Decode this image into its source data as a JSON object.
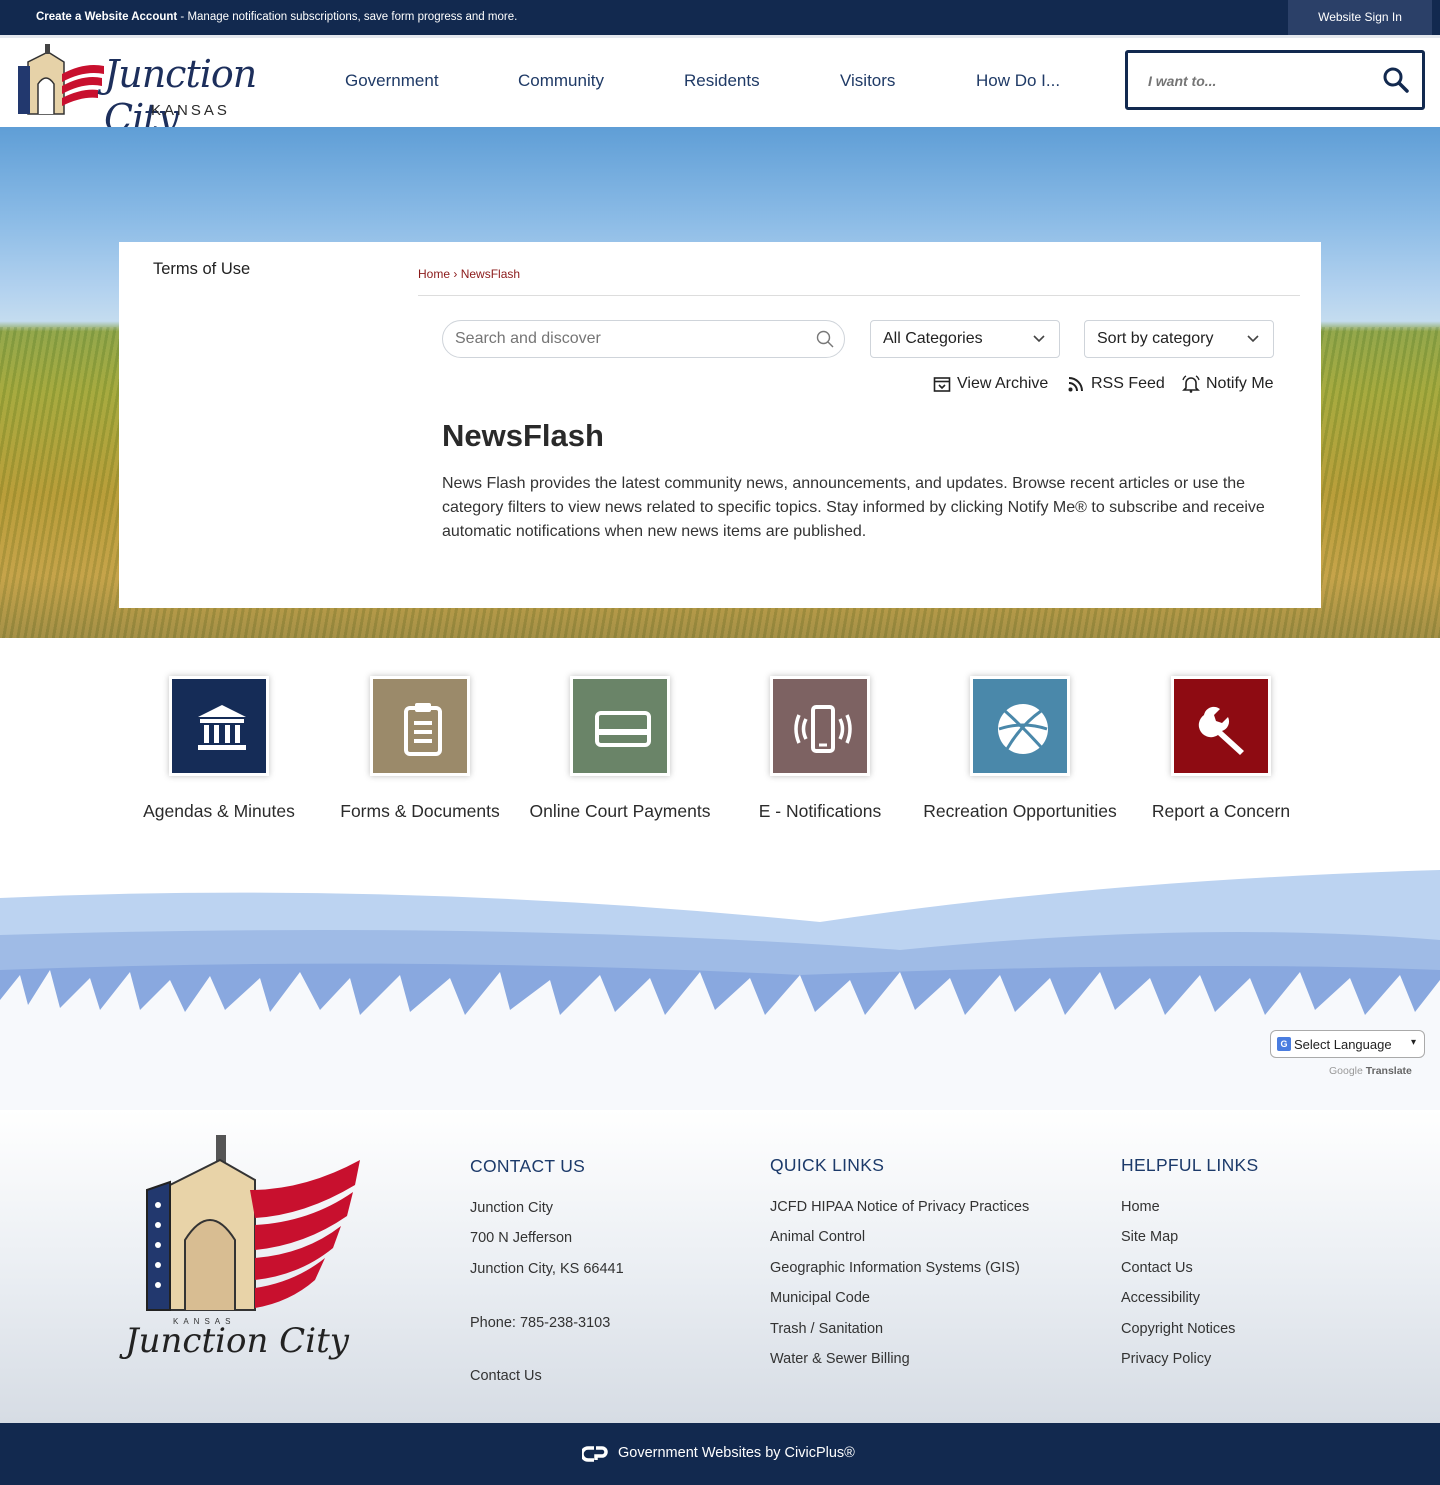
{
  "topbar": {
    "create_account": "Create a Website Account",
    "message": " - Manage notification subscriptions, save form progress and more.",
    "sign_in": "Website Sign In"
  },
  "header": {
    "logo_script": "Junction City",
    "logo_state": "KANSAS",
    "nav": [
      "Government",
      "Community",
      "Residents",
      "Visitors",
      "How Do I..."
    ],
    "iwant_placeholder": "I want to..."
  },
  "sidebar": {
    "link": "Terms of Use"
  },
  "breadcrumb": {
    "home": "Home",
    "separator": " › ",
    "current": "NewsFlash"
  },
  "filters": {
    "search_placeholder": "Search and discover",
    "category": "All Categories",
    "sort": "Sort by category"
  },
  "actions": {
    "archive": "View Archive",
    "rss": "RSS Feed",
    "notify": "Notify Me"
  },
  "page": {
    "title": "NewsFlash",
    "description": "News Flash provides the latest community news, announcements, and updates. Browse recent articles or use the category filters to view news related to specific topics. Stay informed by clicking Notify Me® to subscribe and receive automatic notifications when new news items are published."
  },
  "tiles": [
    {
      "label": "Agendas & Minutes",
      "color": "#152c57",
      "icon": "government-building-icon"
    },
    {
      "label": "Forms & Documents",
      "color": "#9b8a6a",
      "icon": "clipboard-icon"
    },
    {
      "label": "Online Court Payments",
      "color": "#6a8468",
      "icon": "credit-card-icon"
    },
    {
      "label": "E - Notifications",
      "color": "#7d6262",
      "icon": "vibrating-phone-icon"
    },
    {
      "label": "Recreation Opportunities",
      "color": "#4a88aa",
      "icon": "basketball-icon"
    },
    {
      "label": "Report a Concern",
      "color": "#8e0b12",
      "icon": "wrench-icon"
    }
  ],
  "translate": {
    "select": "Select Language",
    "powered_prefix": "Google",
    "powered": "Translate"
  },
  "footer": {
    "contact": {
      "heading": "CONTACT US",
      "name": "Junction City",
      "street": "700 N Jefferson",
      "city": "Junction City, KS 66441",
      "phone": "Phone: 785-238-3103",
      "link": "Contact Us"
    },
    "quick_links": {
      "heading": "QUICK LINKS",
      "items": [
        "JCFD HIPAA Notice of Privacy Practices",
        "Animal Control",
        "Geographic Information Systems (GIS)",
        "Municipal Code",
        "Trash / Sanitation",
        "Water & Sewer Billing"
      ]
    },
    "helpful_links": {
      "heading": "HELPFUL LINKS",
      "items": [
        "Home",
        "Site Map",
        "Contact Us",
        "Accessibility",
        "Copyright Notices",
        "Privacy Policy"
      ]
    },
    "logo_state": "KANSAS",
    "logo_script": "Junction City",
    "credit": "Government Websites by CivicPlus®"
  },
  "colors": {
    "navy": "#12294f",
    "breadcrumb": "#8b1a1a",
    "nav_text": "#1f3a66"
  }
}
